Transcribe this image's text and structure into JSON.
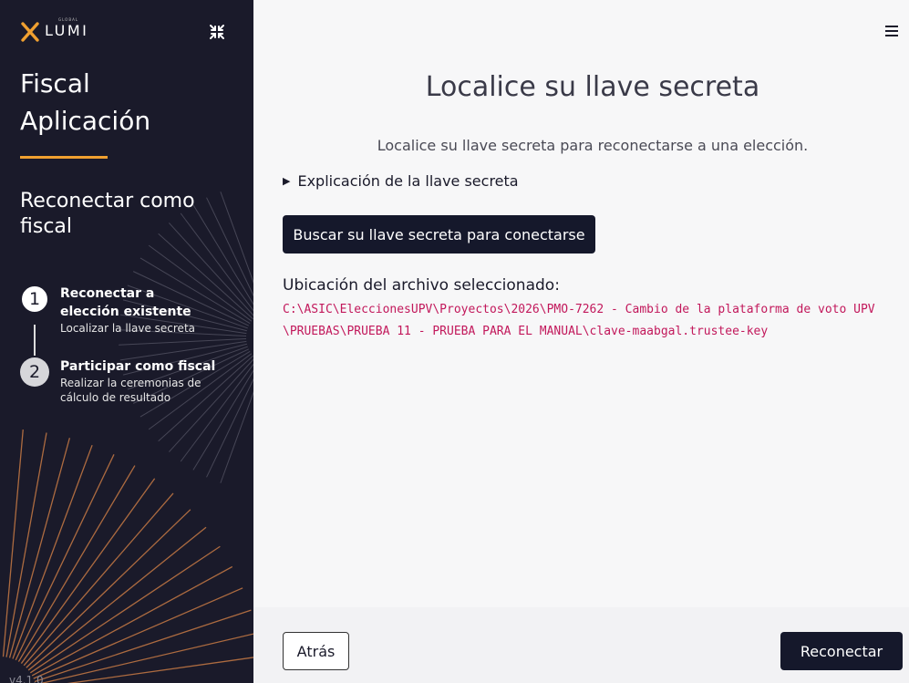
{
  "sidebar": {
    "logo_text": "LUMI",
    "logo_sub": "GLOBAL",
    "title_line1": "Fiscal",
    "title_line2": "Aplicación",
    "subtitle": "Reconectar como fiscal",
    "steps": [
      {
        "number": "1",
        "title": "Reconectar a elección existente",
        "desc": "Localizar la llave secreta",
        "state": "active"
      },
      {
        "number": "2",
        "title": "Participar como fiscal",
        "desc": "Realizar la ceremonias de cálculo de resultado",
        "state": "inactive"
      }
    ],
    "version": "v4.1.0"
  },
  "main": {
    "title": "Localice su llave secreta",
    "instruction": "Localice su llave secreta para reconectarse a una elección.",
    "disclosure_label": "Explicación de la llave secreta",
    "browse_button": "Buscar su llave secreta para conectarse",
    "file_label": "Ubicación del archivo seleccionado:",
    "file_path": "C:\\ASIC\\EleccionesUPV\\Proyectos\\2026\\PMO-7262 - Cambio de la plataforma de voto UPV\\PRUEBAS\\PRUEBA 11 - PRUEBA PARA EL MANUAL\\clave-maabgal.trustee-key"
  },
  "footer": {
    "back_label": "Atrás",
    "reconnect_label": "Reconectar"
  },
  "colors": {
    "sidebar_bg": "#1a1a2a",
    "accent": "#f0a030",
    "primary_button": "#15182b",
    "path_text": "#c2185b"
  }
}
